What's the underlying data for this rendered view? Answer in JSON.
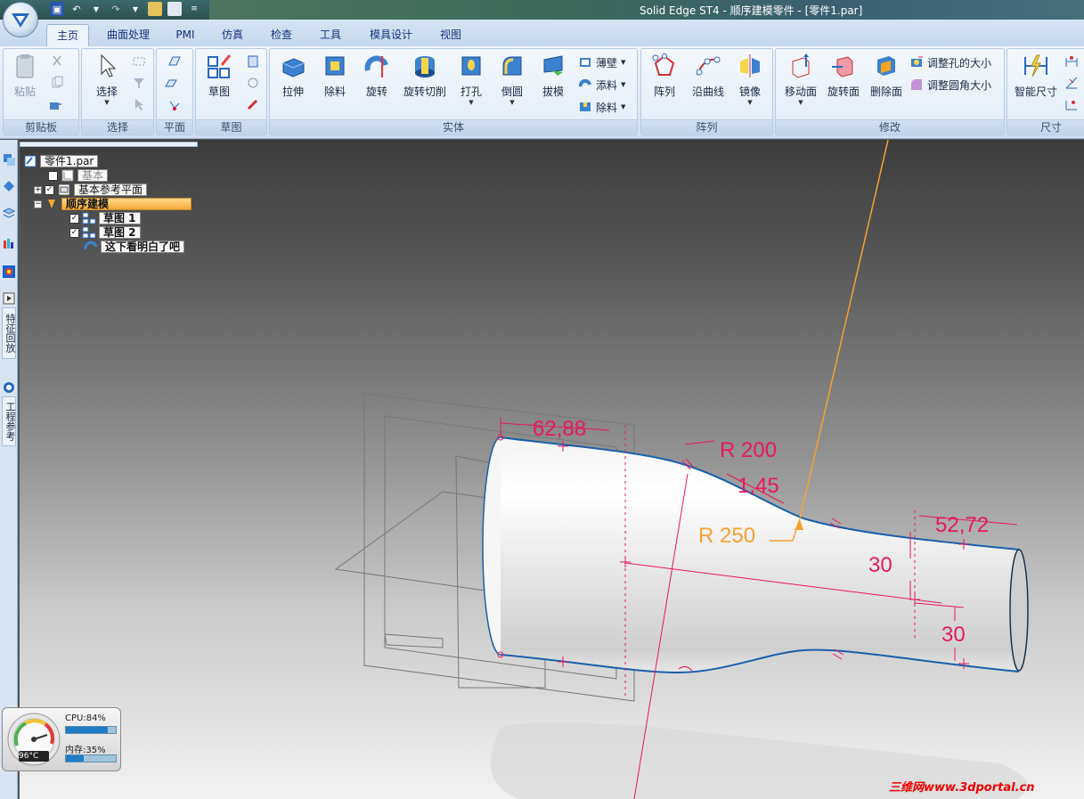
{
  "window": {
    "title": "Solid Edge ST4 - 顺序建模零件 - [零件1.par]"
  },
  "tabs": [
    "主页",
    "曲面处理",
    "PMI",
    "仿真",
    "检查",
    "工具",
    "模具设计",
    "视图"
  ],
  "ribbon": {
    "clipboard": {
      "label": "剪贴板",
      "paste": "粘贴"
    },
    "select": {
      "label": "选择",
      "select": "选择"
    },
    "plane": {
      "label": "平面"
    },
    "sketch": {
      "label": "草图",
      "sketch": "草图"
    },
    "solids": {
      "label": "实体",
      "extrude": "拉伸",
      "cutout": "除料",
      "revolve": "旋转",
      "revolved_cutout": "旋转切削",
      "hole": "打孔",
      "round": "倒圆",
      "draft": "拔模",
      "thin_wall": "薄壁",
      "add_material": "添料",
      "remove_material": "除料"
    },
    "pattern": {
      "label": "阵列",
      "pattern": "阵列",
      "along_curve": "沿曲线",
      "mirror": "镜像"
    },
    "modify": {
      "label": "修改",
      "move_face": "移动面",
      "rotate_face": "旋转面",
      "delete_face": "删除面",
      "resize_hole": "调整孔的大小",
      "resize_round": "调整圆角大小"
    },
    "dimension": {
      "label": "尺寸",
      "smart_dim": "智能尺寸"
    }
  },
  "sidebar": {
    "tab_feature_playback": "特征回放",
    "tab_engineering_reference": "工程参考"
  },
  "tree": {
    "root": "零件1.par",
    "base": "基本",
    "base_planes": "基本参考平面",
    "ordered": "顺序建模",
    "sketch1": "草图 1",
    "sketch2": "草图 2",
    "feature": "这下看明白了吧"
  },
  "dimensions": {
    "d1": "62,88",
    "r200": "R 200",
    "angle": "1,45",
    "r250": "R 250",
    "d2": "52,72",
    "h1": "30",
    "h2": "30"
  },
  "gadget": {
    "cpu": "CPU:84%",
    "mem": "内存:35%",
    "temp": "96°C",
    "cpu_pct": 84,
    "mem_pct": 35
  },
  "watermark": "三维网www.3dportal.cn",
  "colors": {
    "dimension": "#e8195a",
    "leader": "#f7a130",
    "edge": "#1b5fa8",
    "ribbon": "#dde8f5"
  }
}
